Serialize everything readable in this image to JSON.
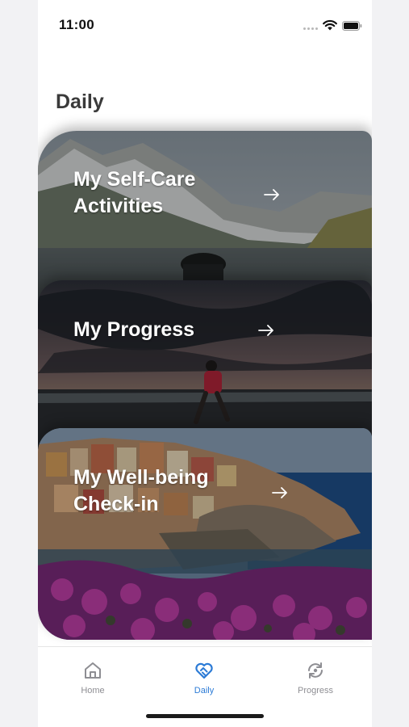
{
  "status_bar": {
    "time": "11:00"
  },
  "page": {
    "title": "Daily"
  },
  "cards": [
    {
      "label": "My Self-Care\nActivities",
      "icon": "arrow-right-icon"
    },
    {
      "label": "My Progress",
      "icon": "arrow-right-icon"
    },
    {
      "label": "My Well-being\nCheck-in",
      "icon": "arrow-right-icon"
    }
  ],
  "tab_bar": {
    "items": [
      {
        "label": "Home",
        "icon": "home-icon",
        "active": false
      },
      {
        "label": "Daily",
        "icon": "heart-handshake-icon",
        "active": true
      },
      {
        "label": "Progress",
        "icon": "refresh-eye-icon",
        "active": false
      }
    ]
  },
  "colors": {
    "accent": "#2c7bd6",
    "inactive": "#8e8e93",
    "title": "#3a3a3a"
  }
}
